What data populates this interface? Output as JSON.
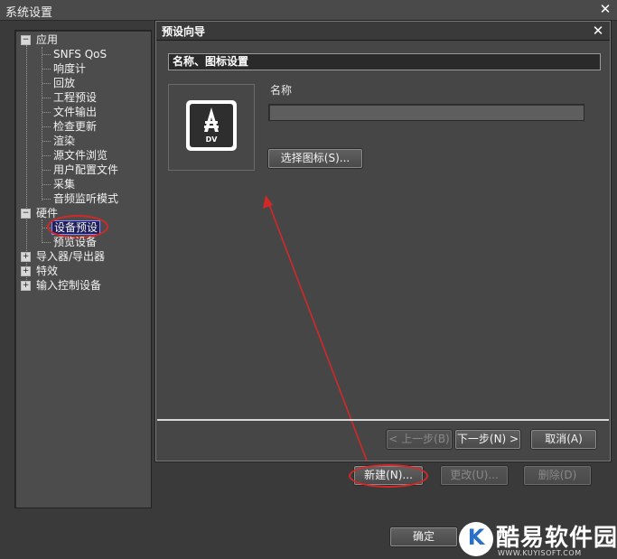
{
  "window": {
    "title": "系统设置"
  },
  "tree": {
    "items": [
      {
        "label": "应用",
        "level": 0,
        "expander": "⊟"
      },
      {
        "label": "SNFS QoS",
        "level": 1
      },
      {
        "label": "响度计",
        "level": 1
      },
      {
        "label": "回放",
        "level": 1
      },
      {
        "label": "工程预设",
        "level": 1
      },
      {
        "label": "文件输出",
        "level": 1
      },
      {
        "label": "检查更新",
        "level": 1
      },
      {
        "label": "渲染",
        "level": 1
      },
      {
        "label": "源文件浏览",
        "level": 1
      },
      {
        "label": "用户配置文件",
        "level": 1
      },
      {
        "label": "采集",
        "level": 1
      },
      {
        "label": "音频监听模式",
        "level": 1
      },
      {
        "label": "硬件",
        "level": 0,
        "expander": "⊟"
      },
      {
        "label": "设备预设",
        "level": 1,
        "selected": true
      },
      {
        "label": "预览设备",
        "level": 1
      },
      {
        "label": "导入器/导出器",
        "level": 0,
        "expander": "⊞"
      },
      {
        "label": "特效",
        "level": 0,
        "expander": "⊞"
      },
      {
        "label": "输入控制设备",
        "level": 0,
        "expander": "⊞"
      }
    ]
  },
  "wizard": {
    "title": "预设向导",
    "section": "名称、图标设置",
    "icon_label": "DV",
    "name_label": "名称",
    "name_value": "",
    "choose_icon": "选择图标(S)...",
    "prev": "< 上一步(B)",
    "next": "下一步(N) >",
    "cancel": "取消(A)"
  },
  "actions": {
    "new": "新建(N)...",
    "edit": "更改(U)...",
    "delete": "删除(D)",
    "ok": "确定"
  },
  "watermark": {
    "text": "酷易软件园",
    "url": "WWW.KUYISOFT.COM",
    "letter": "K"
  },
  "colors": {
    "annotation_red": "#d42828",
    "selection_bg": "#1f1f5a"
  }
}
